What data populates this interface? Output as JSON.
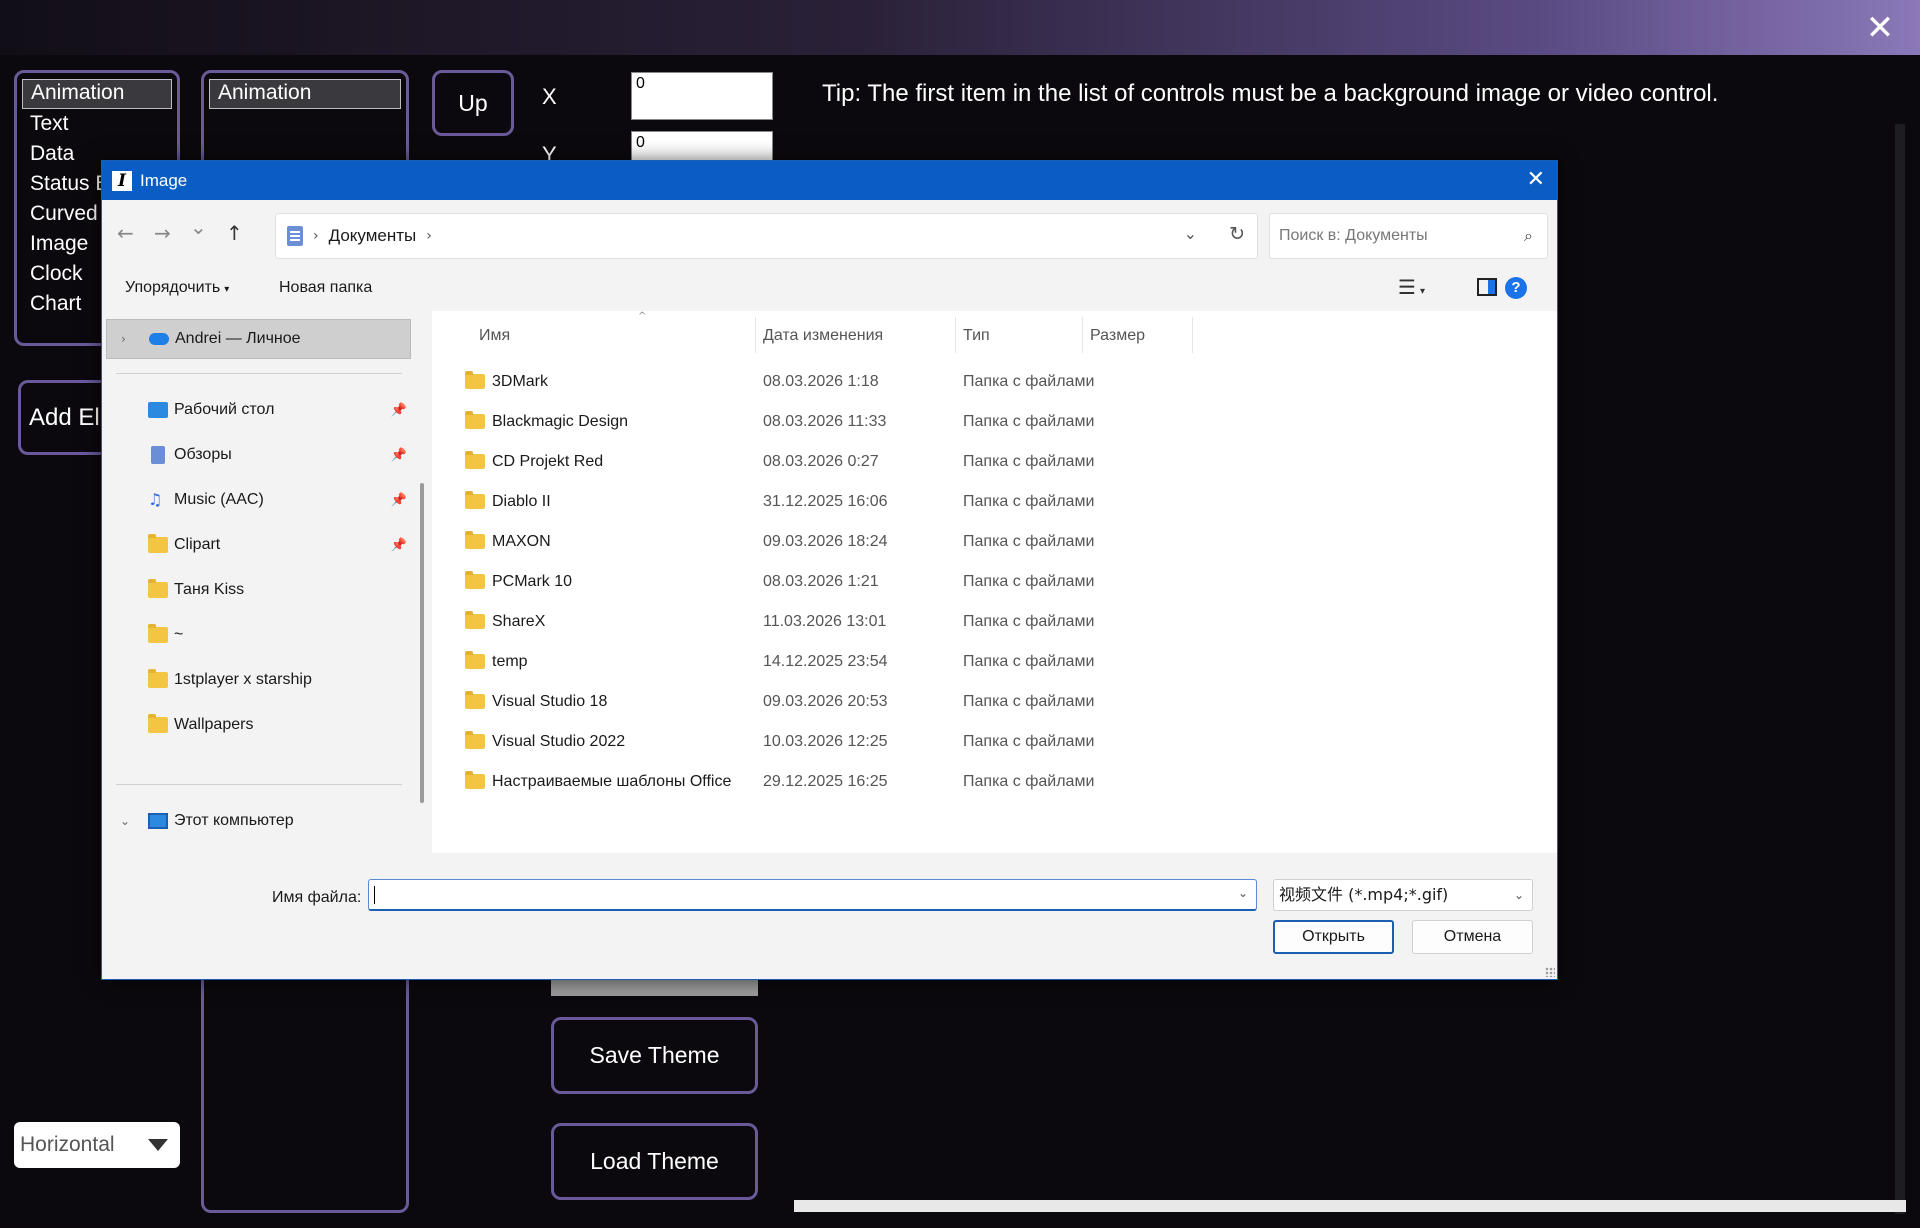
{
  "app": {
    "close_glyph": "✕",
    "accent_border": "#6a5a9a",
    "elements_list": [
      "Animation",
      "Text",
      "Data",
      "Status B",
      "Curved I",
      "Image",
      "Clock",
      "Chart"
    ],
    "controls_list": [
      "Animation"
    ],
    "up_button": "Up",
    "x_label": "X",
    "x_value": "0",
    "y_label": "Y",
    "y_value": "0",
    "add_button": "Add El",
    "tip": "Tip: The first item in the list of controls must be a background image or video control.",
    "orientation": "Horizontal",
    "save_theme": "Save Theme",
    "load_theme": "Load Theme"
  },
  "dialog": {
    "title": "Image",
    "app_icon_glyph": "I",
    "close_glyph": "✕",
    "nav": {
      "back": "←",
      "forward": "→",
      "recent": "⌄",
      "up": "↑"
    },
    "breadcrumb": [
      "Документы"
    ],
    "search_placeholder": "Поиск в: Документы",
    "commands": {
      "organize": "Упорядочить",
      "new_folder": "Новая папка"
    },
    "nav_pane": {
      "cloud": "Andrei — Личное",
      "quick_access": [
        {
          "label": "Рабочий стол",
          "icon": "desktop-icon",
          "pinned": true
        },
        {
          "label": "Обзоры",
          "icon": "document-icon",
          "pinned": true
        },
        {
          "label": "Music (AAC)",
          "icon": "music-icon",
          "pinned": true
        },
        {
          "label": "Clipart",
          "icon": "folder-icon",
          "pinned": true
        },
        {
          "label": "Таня Kiss",
          "icon": "folder-icon",
          "pinned": false
        },
        {
          "label": "~",
          "icon": "folder-icon",
          "pinned": false
        },
        {
          "label": "1stplayer x starship",
          "icon": "folder-icon",
          "pinned": false
        },
        {
          "label": "Wallpapers",
          "icon": "folder-icon",
          "pinned": false
        }
      ],
      "this_pc": "Этот компьютер"
    },
    "columns": {
      "name": "Имя",
      "date": "Дата изменения",
      "type": "Тип",
      "size": "Размер"
    },
    "files": [
      {
        "name": "3DMark",
        "date": "08.03.2026 1:18",
        "type": "Папка с файлами"
      },
      {
        "name": "Blackmagic Design",
        "date": "08.03.2026 11:33",
        "type": "Папка с файлами"
      },
      {
        "name": "CD Projekt Red",
        "date": "08.03.2026 0:27",
        "type": "Папка с файлами"
      },
      {
        "name": "Diablo II",
        "date": "31.12.2025 16:06",
        "type": "Папка с файлами"
      },
      {
        "name": "MAXON",
        "date": "09.03.2026 18:24",
        "type": "Папка с файлами"
      },
      {
        "name": "PCMark 10",
        "date": "08.03.2026 1:21",
        "type": "Папка с файлами"
      },
      {
        "name": "ShareX",
        "date": "11.03.2026 13:01",
        "type": "Папка с файлами"
      },
      {
        "name": "temp",
        "date": "14.12.2025 23:54",
        "type": "Папка с файлами"
      },
      {
        "name": "Visual Studio 18",
        "date": "09.03.2026 20:53",
        "type": "Папка с файлами"
      },
      {
        "name": "Visual Studio 2022",
        "date": "10.03.2026 12:25",
        "type": "Папка с файлами"
      },
      {
        "name": "Настраиваемые шаблоны Office",
        "date": "29.12.2025 16:25",
        "type": "Папка с файлами"
      }
    ],
    "filename_label": "Имя файла:",
    "filename_value": "",
    "filetype": "视频文件 (*.mp4;*.gif)",
    "open_button": "Открыть",
    "cancel_button": "Отмена"
  }
}
